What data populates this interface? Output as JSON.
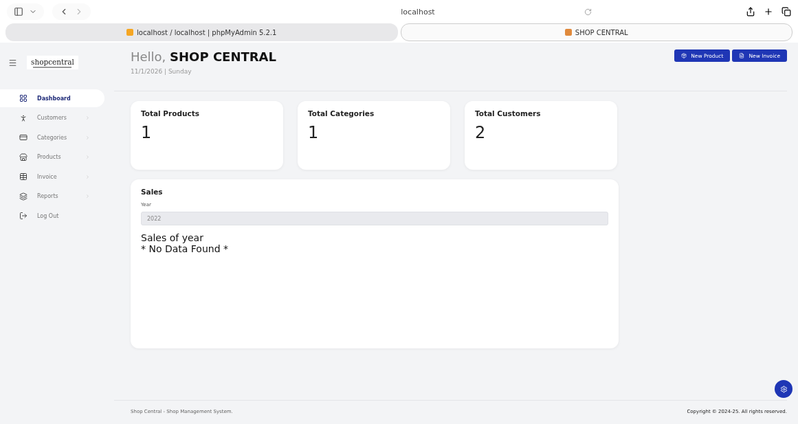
{
  "browser": {
    "address": "localhost",
    "tabs": [
      {
        "title": "localhost / localhost | phpMyAdmin 5.2.1",
        "selected": false
      },
      {
        "title": "SHOP CENTRAL",
        "selected": true
      }
    ]
  },
  "sidebar": {
    "logo": "shopcentral",
    "items": [
      {
        "label": "Dashboard",
        "selected": true,
        "submenu": false
      },
      {
        "label": "Customers",
        "selected": false,
        "submenu": true
      },
      {
        "label": "Categories",
        "selected": false,
        "submenu": true
      },
      {
        "label": "Products",
        "selected": false,
        "submenu": true
      },
      {
        "label": "Invoice",
        "selected": false,
        "submenu": true
      },
      {
        "label": "Reports",
        "selected": false,
        "submenu": true
      },
      {
        "label": "Log Out",
        "selected": false,
        "submenu": false
      }
    ]
  },
  "header": {
    "greeting": "Hello,",
    "name": "SHOP CENTRAL",
    "date": "11/1/2026 | Sunday",
    "buttons": [
      "New Product",
      "New Invoice"
    ]
  },
  "stats": [
    {
      "label": "Total Products",
      "value": "1"
    },
    {
      "label": "Total Categories",
      "value": "1"
    },
    {
      "label": "Total Customers",
      "value": "2"
    }
  ],
  "sales": {
    "title": "Sales",
    "year_label": "Year",
    "year_value": "2022",
    "year_disabled": true,
    "chart_title": "Sales of year",
    "empty_message": "* No Data Found *"
  },
  "footer": {
    "left": "Shop Central - Shop Management System.",
    "right": "Copyright © 2024-25. All rights reserved."
  }
}
